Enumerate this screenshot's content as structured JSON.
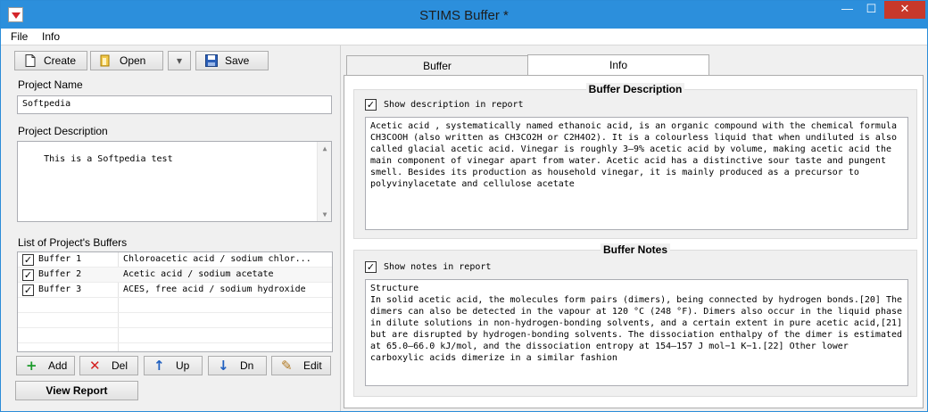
{
  "window": {
    "title": "STIMS Buffer *",
    "min_glyph": "—",
    "max_glyph": "☐",
    "close_glyph": "✕"
  },
  "menu": [
    "File",
    "Info"
  ],
  "toolbar": {
    "create": "Create",
    "open": "Open",
    "save": "Save"
  },
  "project": {
    "name_label": "Project Name",
    "name_value": "Softpedia",
    "desc_label": "Project Description",
    "desc_value": "This is a Softpedia test"
  },
  "buffers": {
    "label": "List of Project's Buffers",
    "rows": [
      {
        "checked": true,
        "name": "Buffer 1",
        "desc": "Chloroacetic acid / sodium chlor..."
      },
      {
        "checked": true,
        "name": "Buffer 2",
        "desc": "Acetic acid / sodium acetate"
      },
      {
        "checked": true,
        "name": "Buffer 3",
        "desc": "ACES, free acid / sodium hydroxide"
      }
    ],
    "actions": {
      "add": "Add",
      "del": "Del",
      "up": "Up",
      "dn": "Dn",
      "edit": "Edit"
    },
    "view_report": "View Report"
  },
  "tabs": {
    "buffer": "Buffer",
    "info": "Info",
    "active": "info"
  },
  "description": {
    "title": "Buffer Description",
    "show_label": "Show description in report",
    "show_checked": true,
    "text": "Acetic acid , systematically named ethanoic acid, is an organic compound with the chemical formula CH3COOH (also written as CH3CO2H or C2H4O2). It is a colourless liquid that when undiluted is also called glacial acetic acid. Vinegar is roughly 3–9% acetic acid by volume, making acetic acid the main component of vinegar apart from water. Acetic acid has a distinctive sour taste and pungent smell. Besides its production as household vinegar, it is mainly produced as a precursor to polyvinylacetate and cellulose acetate"
  },
  "notes": {
    "title": "Buffer Notes",
    "show_label": "Show notes in report",
    "show_checked": true,
    "text": "Structure\nIn solid acetic acid, the molecules form pairs (dimers), being connected by hydrogen bonds.[20] The dimers can also be detected in the vapour at 120 °C (248 °F). Dimers also occur in the liquid phase in dilute solutions in non-hydrogen-bonding solvents, and a certain extent in pure acetic acid,[21] but are disrupted by hydrogen-bonding solvents. The dissociation enthalpy of the dimer is estimated at 65.0–66.0 kJ/mol, and the dissociation entropy at 154–157 J mol−1 K−1.[22] Other lower carboxylic acids dimerize in a similar fashion"
  },
  "glyphs": {
    "check": "✓",
    "scroll_up": "▲",
    "scroll_down": "▼",
    "add": "+",
    "del": "✕",
    "up": "↑",
    "dn": "↓",
    "edit": "✎",
    "dropdown": "▾"
  },
  "colors": {
    "titlebar": "#2c8fdc",
    "close": "#c7382b",
    "add": "#1a9a2a",
    "del": "#d42020",
    "arrow": "#2060c0"
  }
}
